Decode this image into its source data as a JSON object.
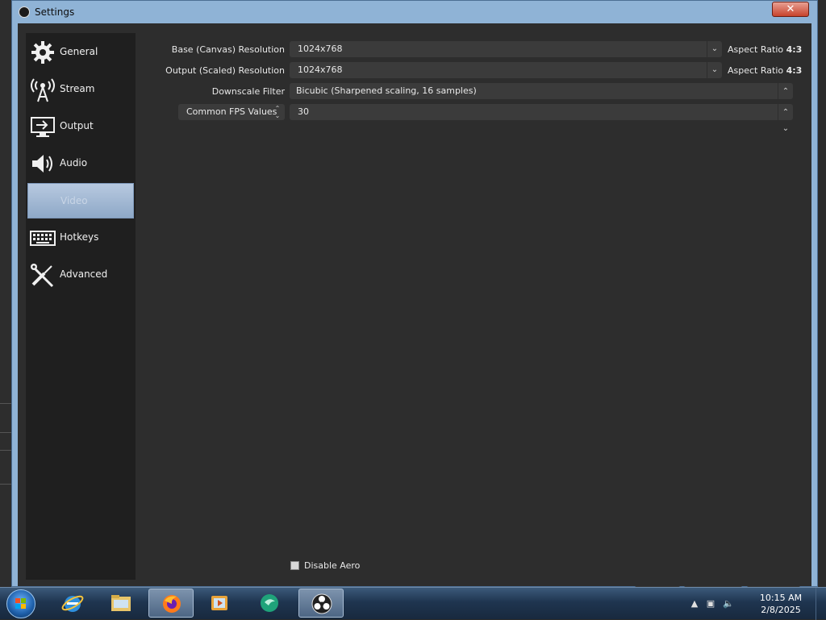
{
  "window": {
    "title": "Settings",
    "close_label": "✕"
  },
  "sidebar": {
    "items": [
      {
        "label": "General",
        "icon": "gear-icon"
      },
      {
        "label": "Stream",
        "icon": "antenna-icon"
      },
      {
        "label": "Output",
        "icon": "monitor-icon"
      },
      {
        "label": "Audio",
        "icon": "speaker-icon"
      },
      {
        "label": "Video",
        "icon": "video-icon",
        "selected": true
      },
      {
        "label": "Hotkeys",
        "icon": "keyboard-icon"
      },
      {
        "label": "Advanced",
        "icon": "wrench-screwdriver-icon"
      }
    ]
  },
  "video": {
    "base_resolution": {
      "label": "Base (Canvas) Resolution",
      "value": "1024x768",
      "aspect_label": "Aspect Ratio",
      "aspect_value": "4:3"
    },
    "output_resolution": {
      "label": "Output (Scaled) Resolution",
      "value": "1024x768",
      "aspect_label": "Aspect Ratio",
      "aspect_value": "4:3"
    },
    "downscale_filter": {
      "label": "Downscale Filter",
      "value": "Bicubic (Sharpened scaling, 16 samples)"
    },
    "fps": {
      "label": "Common FPS Values",
      "value": "30"
    },
    "disable_aero": {
      "label": "Disable Aero",
      "checked": false
    }
  },
  "taskbar": {
    "apps": [
      "internet-explorer-icon",
      "file-explorer-icon",
      "firefox-icon",
      "media-player-icon",
      "green-app-icon",
      "obs-icon"
    ],
    "clock_time": "10:15 AM",
    "clock_date": "2/8/2025"
  },
  "colors": {
    "accent": "#8ea8c7",
    "panel": "#2d2d2d",
    "sidebar": "#1f1f1f",
    "field": "#3b3b3b"
  }
}
